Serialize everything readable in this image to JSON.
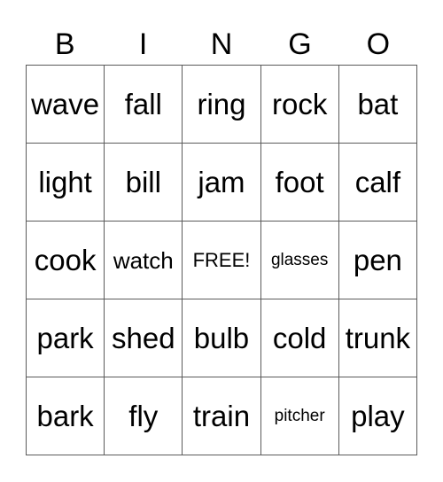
{
  "header": [
    "B",
    "I",
    "N",
    "G",
    "O"
  ],
  "cells": [
    [
      "wave",
      "fall",
      "ring",
      "rock",
      "bat"
    ],
    [
      "light",
      "bill",
      "jam",
      "foot",
      "calf"
    ],
    [
      "cook",
      "watch",
      "FREE!",
      "glasses",
      "pen"
    ],
    [
      "park",
      "shed",
      "bulb",
      "cold",
      "trunk"
    ],
    [
      "bark",
      "fly",
      "train",
      "pitcher",
      "play"
    ]
  ]
}
